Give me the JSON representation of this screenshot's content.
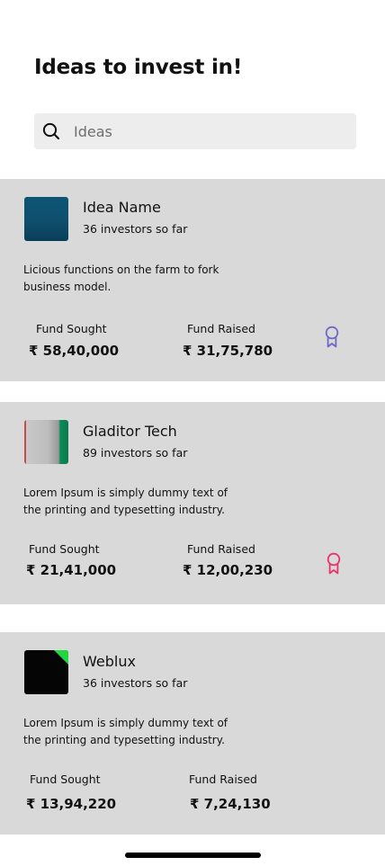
{
  "header": {
    "title": "Ideas to invest in!"
  },
  "search": {
    "placeholder": "Ideas",
    "value": "",
    "icon": "search-icon"
  },
  "ideas": [
    {
      "name": "Idea Name",
      "investors": "36 investors so far",
      "description": "Licious functions on the farm to fork business model.",
      "fund_sought_label": "Fund Sought",
      "fund_sought": "₹ 58,40,000",
      "fund_raised_label": "Fund Raised",
      "fund_raised": "₹ 31,75,780",
      "badge_icon": "award-ribbon-icon",
      "badge_color": "#6f68c9"
    },
    {
      "name": "Gladitor Tech",
      "investors": "89 investors so far",
      "description": "Lorem Ipsum is simply dummy text of the printing and typesetting industry.",
      "fund_sought_label": "Fund Sought",
      "fund_sought": "₹ 21,41,000",
      "fund_raised_label": "Fund Raised",
      "fund_raised": "₹ 12,00,230",
      "badge_icon": "award-ribbon-icon",
      "badge_color": "#e8336b"
    },
    {
      "name": "Weblux",
      "investors": "36 investors so far",
      "description": "Lorem Ipsum is simply dummy text of the printing and typesetting industry.",
      "fund_sought_label": "Fund Sought",
      "fund_sought": "₹ 13,94,220",
      "fund_raised_label": "Fund Raised",
      "fund_raised": "₹ 7,24,130"
    }
  ],
  "colors": {
    "card_background": "#d9d9d9",
    "search_background": "#ededed",
    "accent_badge_1": "#6f68c9",
    "accent_badge_2": "#e8336b"
  }
}
